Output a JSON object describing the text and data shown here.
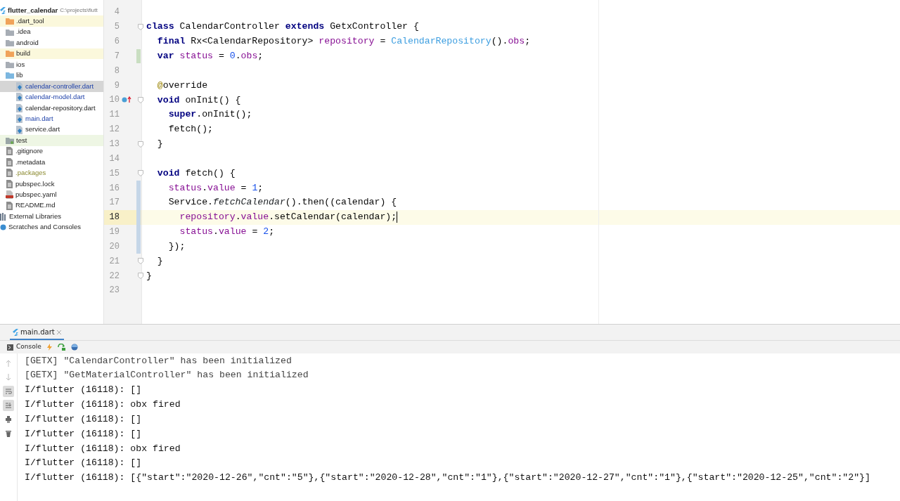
{
  "project": {
    "name": "flutter_calendar",
    "path": "C:\\projects\\flutt"
  },
  "tree": [
    {
      "label": ".dart_tool",
      "kind": "folder",
      "excluded": true,
      "test_root": false,
      "ignored": false,
      "selected": false,
      "modified": false
    },
    {
      "label": ".idea",
      "kind": "folder",
      "excluded": false,
      "test_root": false,
      "ignored": false,
      "selected": false,
      "modified": false
    },
    {
      "label": "android",
      "kind": "folder",
      "excluded": false,
      "test_root": false,
      "ignored": false,
      "selected": false,
      "modified": false
    },
    {
      "label": "build",
      "kind": "folder",
      "excluded": true,
      "test_root": false,
      "ignored": false,
      "selected": false,
      "modified": false
    },
    {
      "label": "ios",
      "kind": "folder",
      "excluded": false,
      "test_root": false,
      "ignored": false,
      "selected": false,
      "modified": false
    },
    {
      "label": "lib",
      "kind": "source",
      "excluded": false,
      "test_root": false,
      "ignored": false,
      "selected": false,
      "modified": false,
      "children": [
        {
          "label": "calendar-controller.dart",
          "kind": "dart",
          "excluded": false,
          "test_root": false,
          "ignored": false,
          "selected": true,
          "modified": true
        },
        {
          "label": "calendar-model.dart",
          "kind": "dart",
          "excluded": false,
          "test_root": false,
          "ignored": false,
          "selected": false,
          "modified": true
        },
        {
          "label": "calendar-repository.dart",
          "kind": "dart",
          "excluded": false,
          "test_root": false,
          "ignored": false,
          "selected": false,
          "modified": false
        },
        {
          "label": "main.dart",
          "kind": "dart",
          "excluded": false,
          "test_root": false,
          "ignored": false,
          "selected": false,
          "modified": true
        },
        {
          "label": "service.dart",
          "kind": "dart",
          "excluded": false,
          "test_root": false,
          "ignored": false,
          "selected": false,
          "modified": false
        }
      ]
    },
    {
      "label": "test",
      "kind": "folder",
      "excluded": false,
      "test_root": true,
      "ignored": false,
      "selected": false,
      "modified": false
    },
    {
      "label": ".gitignore",
      "kind": "file",
      "excluded": false,
      "test_root": false,
      "ignored": false,
      "selected": false,
      "modified": false
    },
    {
      "label": ".metadata",
      "kind": "file",
      "excluded": false,
      "test_root": false,
      "ignored": false,
      "selected": false,
      "modified": false
    },
    {
      "label": ".packages",
      "kind": "file",
      "excluded": false,
      "test_root": false,
      "ignored": true,
      "selected": false,
      "modified": false
    },
    {
      "label": "pubspec.lock",
      "kind": "file",
      "excluded": false,
      "test_root": false,
      "ignored": false,
      "selected": false,
      "modified": false
    },
    {
      "label": "pubspec.yaml",
      "kind": "yaml",
      "excluded": false,
      "test_root": false,
      "ignored": false,
      "selected": false,
      "modified": false
    },
    {
      "label": "README.md",
      "kind": "file",
      "excluded": false,
      "test_root": false,
      "ignored": false,
      "selected": false,
      "modified": false
    }
  ],
  "extra_nodes": [
    {
      "label": "External Libraries",
      "kind": "library"
    },
    {
      "label": "Scratches and Consoles",
      "kind": "scratches"
    }
  ],
  "editor": {
    "lines": [
      {
        "number": "4",
        "added": false,
        "modified": false,
        "current": false,
        "fold": false,
        "override": false
      },
      {
        "number": "5",
        "tokens": [
          {
            "text": "class",
            "kind": "keyword"
          },
          {
            "text": " CalendarController ",
            "kind": "plain"
          },
          {
            "text": "extends",
            "kind": "keyword"
          },
          {
            "text": " GetxController {",
            "kind": "plain"
          }
        ],
        "added": false,
        "modified": false,
        "current": false,
        "fold": true,
        "override": false
      },
      {
        "number": "6",
        "tokens": [
          {
            "text": "  final",
            "kind": "keyword"
          },
          {
            "text": " Rx<CalendarRepository> ",
            "kind": "plain"
          },
          {
            "text": "repository",
            "kind": "field"
          },
          {
            "text": " = ",
            "kind": "plain"
          },
          {
            "text": "CalendarRepository",
            "kind": "constructor"
          },
          {
            "text": "().",
            "kind": "plain"
          },
          {
            "text": "obs",
            "kind": "field"
          },
          {
            "text": ";",
            "kind": "plain"
          }
        ],
        "added": false,
        "modified": false,
        "current": false,
        "fold": false,
        "override": false
      },
      {
        "number": "7",
        "tokens": [
          {
            "text": "  var",
            "kind": "keyword"
          },
          {
            "text": " status",
            "kind": "field"
          },
          {
            "text": " = ",
            "kind": "plain"
          },
          {
            "text": "0",
            "kind": "number"
          },
          {
            "text": ".",
            "kind": "plain"
          },
          {
            "text": "obs",
            "kind": "field"
          },
          {
            "text": ";",
            "kind": "plain"
          }
        ],
        "added": true,
        "modified": false,
        "current": false,
        "fold": false,
        "override": false
      },
      {
        "number": "8",
        "added": false,
        "modified": false,
        "current": false,
        "fold": false,
        "override": false
      },
      {
        "number": "9",
        "tokens": [
          {
            "text": "  @",
            "kind": "annotation"
          },
          {
            "text": "override",
            "kind": "plain"
          }
        ],
        "added": false,
        "modified": false,
        "current": false,
        "fold": false,
        "override": false
      },
      {
        "number": "10",
        "tokens": [
          {
            "text": "  void",
            "kind": "keyword"
          },
          {
            "text": " onInit() {",
            "kind": "plain"
          }
        ],
        "added": false,
        "modified": false,
        "current": false,
        "fold": true,
        "override": true
      },
      {
        "number": "11",
        "tokens": [
          {
            "text": "    super",
            "kind": "keyword"
          },
          {
            "text": ".onInit();",
            "kind": "plain"
          }
        ],
        "added": false,
        "modified": false,
        "current": false,
        "fold": false,
        "override": false
      },
      {
        "number": "12",
        "tokens": [
          {
            "text": "    fetch();",
            "kind": "plain"
          }
        ],
        "added": false,
        "modified": false,
        "current": false,
        "fold": false,
        "override": false
      },
      {
        "number": "13",
        "tokens": [
          {
            "text": "  }",
            "kind": "plain"
          }
        ],
        "added": false,
        "modified": false,
        "current": false,
        "fold": true,
        "override": false
      },
      {
        "number": "14",
        "added": false,
        "modified": false,
        "current": false,
        "fold": false,
        "override": false
      },
      {
        "number": "15",
        "tokens": [
          {
            "text": "  void",
            "kind": "keyword"
          },
          {
            "text": " fetch() {",
            "kind": "plain"
          }
        ],
        "added": false,
        "modified": false,
        "current": false,
        "fold": true,
        "override": false
      },
      {
        "number": "16",
        "tokens": [
          {
            "text": "    status",
            "kind": "field"
          },
          {
            "text": ".",
            "kind": "plain"
          },
          {
            "text": "value",
            "kind": "field"
          },
          {
            "text": " = ",
            "kind": "plain"
          },
          {
            "text": "1",
            "kind": "number"
          },
          {
            "text": ";",
            "kind": "plain"
          }
        ],
        "added": false,
        "modified": true,
        "current": false,
        "fold": false,
        "override": false
      },
      {
        "number": "17",
        "tokens": [
          {
            "text": "    Service.",
            "kind": "plain"
          },
          {
            "text": "fetchCalendar",
            "kind": "static"
          },
          {
            "text": "().then((calendar) {",
            "kind": "plain"
          }
        ],
        "added": false,
        "modified": true,
        "current": false,
        "fold": false,
        "override": false
      },
      {
        "number": "18",
        "tokens": [
          {
            "text": "      repository",
            "kind": "field"
          },
          {
            "text": ".",
            "kind": "plain"
          },
          {
            "text": "value",
            "kind": "field"
          },
          {
            "text": ".setCalendar(calendar);",
            "kind": "plain"
          }
        ],
        "added": false,
        "modified": true,
        "current": true,
        "fold": false,
        "override": false
      },
      {
        "number": "19",
        "tokens": [
          {
            "text": "      status",
            "kind": "field"
          },
          {
            "text": ".",
            "kind": "plain"
          },
          {
            "text": "value",
            "kind": "field"
          },
          {
            "text": " = ",
            "kind": "plain"
          },
          {
            "text": "2",
            "kind": "number"
          },
          {
            "text": ";",
            "kind": "plain"
          }
        ],
        "added": false,
        "modified": true,
        "current": false,
        "fold": false,
        "override": false
      },
      {
        "number": "20",
        "tokens": [
          {
            "text": "    });",
            "kind": "plain"
          }
        ],
        "added": false,
        "modified": true,
        "current": false,
        "fold": false,
        "override": false
      },
      {
        "number": "21",
        "tokens": [
          {
            "text": "  }",
            "kind": "plain"
          }
        ],
        "added": false,
        "modified": false,
        "current": false,
        "fold": true,
        "override": false
      },
      {
        "number": "22",
        "tokens": [
          {
            "text": "}",
            "kind": "plain"
          }
        ],
        "added": false,
        "modified": false,
        "current": false,
        "fold": true,
        "override": false
      },
      {
        "number": "23",
        "added": false,
        "modified": false,
        "current": false,
        "fold": false,
        "override": false
      }
    ]
  },
  "run_panel": {
    "tab": "main.dart",
    "console_label": "Console",
    "lines": [
      {
        "text": "[GETX] \"CalendarController\" has been initialized",
        "kind": "system"
      },
      {
        "text": "[GETX] \"GetMaterialController\" has been initialized",
        "kind": "system"
      },
      {
        "text": "I/flutter (16118): []",
        "kind": "output"
      },
      {
        "text": "I/flutter (16118): obx fired",
        "kind": "output"
      },
      {
        "text": "I/flutter (16118): []",
        "kind": "output"
      },
      {
        "text": "I/flutter (16118): []",
        "kind": "output"
      },
      {
        "text": "I/flutter (16118): obx fired",
        "kind": "output"
      },
      {
        "text": "I/flutter (16118): []",
        "kind": "output"
      },
      {
        "text": "I/flutter (16118): [{\"start\":\"2020-12-26\",\"cnt\":\"5\"},{\"start\":\"2020-12-28\",\"cnt\":\"1\"},{\"start\":\"2020-12-27\",\"cnt\":\"1\"},{\"start\":\"2020-12-25\",\"cnt\":\"2\"}]",
        "kind": "output"
      }
    ]
  }
}
